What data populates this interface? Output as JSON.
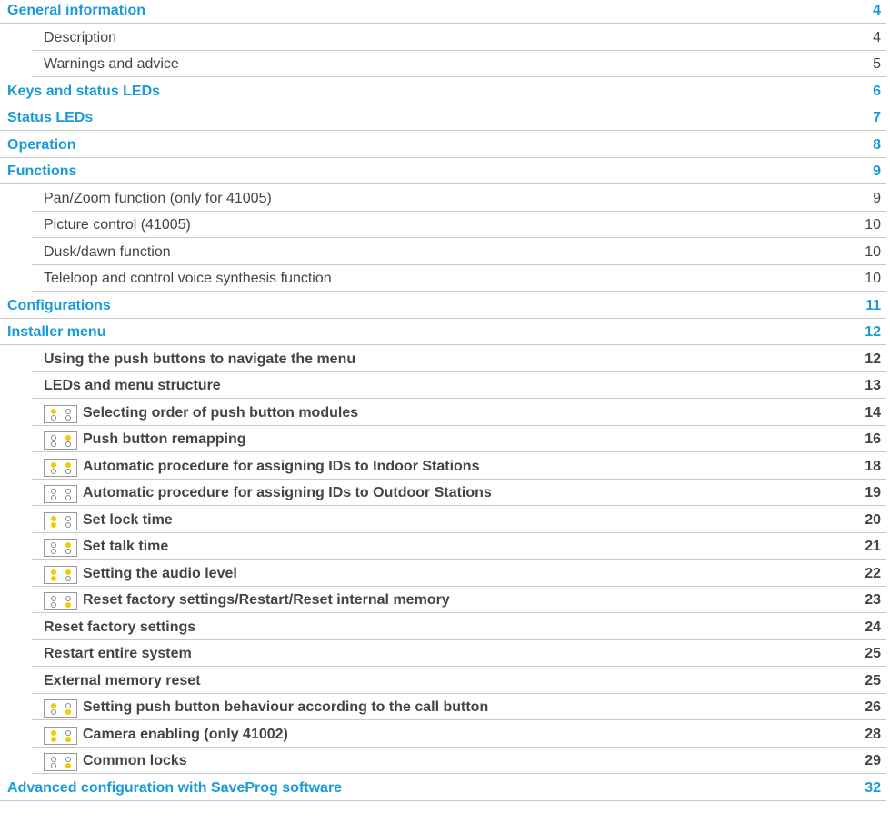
{
  "led_colors": {
    "on": "#f5c800",
    "off": "#ffffff",
    "heading": "#1a9bd6"
  },
  "toc": [
    {
      "level": 1,
      "title": "General information",
      "page": "4"
    },
    {
      "level": 2,
      "title": "Description",
      "page": "4"
    },
    {
      "level": 2,
      "title": "Warnings and advice",
      "page": "5"
    },
    {
      "level": 1,
      "title": "Keys and status LEDs",
      "page": "6"
    },
    {
      "level": 1,
      "title": "Status LEDs",
      "page": "7"
    },
    {
      "level": 1,
      "title": "Operation",
      "page": "8"
    },
    {
      "level": 1,
      "title": "Functions",
      "page": "9"
    },
    {
      "level": 2,
      "title": "Pan/Zoom function (only for 41005)",
      "page": "9"
    },
    {
      "level": 2,
      "title": "Picture control (41005)",
      "page": "10"
    },
    {
      "level": 2,
      "title": "Dusk/dawn function",
      "page": "10"
    },
    {
      "level": 2,
      "title": "Teleloop and control voice synthesis function",
      "page": "10"
    },
    {
      "level": 1,
      "title": "Configurations",
      "page": "11"
    },
    {
      "level": 1,
      "title": "Installer menu",
      "page": "12"
    },
    {
      "level": 3,
      "title": "Using the push buttons to navigate the menu",
      "page": "12"
    },
    {
      "level": 3,
      "title": "LEDs and menu structure",
      "page": "13"
    },
    {
      "level": 3,
      "title": "Selecting order of push button modules",
      "page": "14",
      "leds": {
        "l_top": true,
        "l_bot": false,
        "r_top": false,
        "r_bot": false
      }
    },
    {
      "level": 3,
      "title": "Push button remapping",
      "page": "16",
      "leds": {
        "l_top": false,
        "l_bot": false,
        "r_top": true,
        "r_bot": false
      }
    },
    {
      "level": 3,
      "title": "Automatic procedure for assigning IDs to Indoor Stations",
      "page": "18",
      "leds": {
        "l_top": true,
        "l_bot": false,
        "r_top": true,
        "r_bot": false
      }
    },
    {
      "level": 3,
      "title": "Automatic procedure for assigning IDs to Outdoor Stations",
      "page": "19",
      "leds": {
        "l_top": false,
        "l_bot": false,
        "r_top": false,
        "r_bot": false
      }
    },
    {
      "level": 3,
      "title": "Set lock time",
      "page": "20",
      "leds": {
        "l_top": true,
        "l_bot": true,
        "r_top": false,
        "r_bot": false
      }
    },
    {
      "level": 3,
      "title": "Set talk time",
      "page": "21",
      "leds": {
        "l_top": false,
        "l_bot": false,
        "r_top": true,
        "r_bot": false
      }
    },
    {
      "level": 3,
      "title": "Setting the audio level",
      "page": "22",
      "leds": {
        "l_top": true,
        "l_bot": true,
        "r_top": true,
        "r_bot": false
      }
    },
    {
      "level": 3,
      "title": "Reset factory settings/Restart/Reset internal memory",
      "page": "23",
      "leds": {
        "l_top": false,
        "l_bot": false,
        "r_top": false,
        "r_bot": true
      }
    },
    {
      "level": 3,
      "title": "Reset factory settings",
      "page": "24"
    },
    {
      "level": 3,
      "title": "Restart entire system",
      "page": "25"
    },
    {
      "level": 3,
      "title": "External memory reset",
      "page": "25"
    },
    {
      "level": 3,
      "title": "Setting push button behaviour according to the call button",
      "page": "26",
      "leds": {
        "l_top": true,
        "l_bot": false,
        "r_top": false,
        "r_bot": true
      }
    },
    {
      "level": 3,
      "title": "Camera enabling (only 41002)",
      "page": "28",
      "leds": {
        "l_top": true,
        "l_bot": true,
        "r_top": false,
        "r_bot": true
      }
    },
    {
      "level": 3,
      "title": "Common locks",
      "page": "29",
      "leds": {
        "l_top": false,
        "l_bot": false,
        "r_top": false,
        "r_bot": true
      }
    },
    {
      "level": 1,
      "title": "Advanced configuration with SaveProg software",
      "page": "32"
    }
  ]
}
